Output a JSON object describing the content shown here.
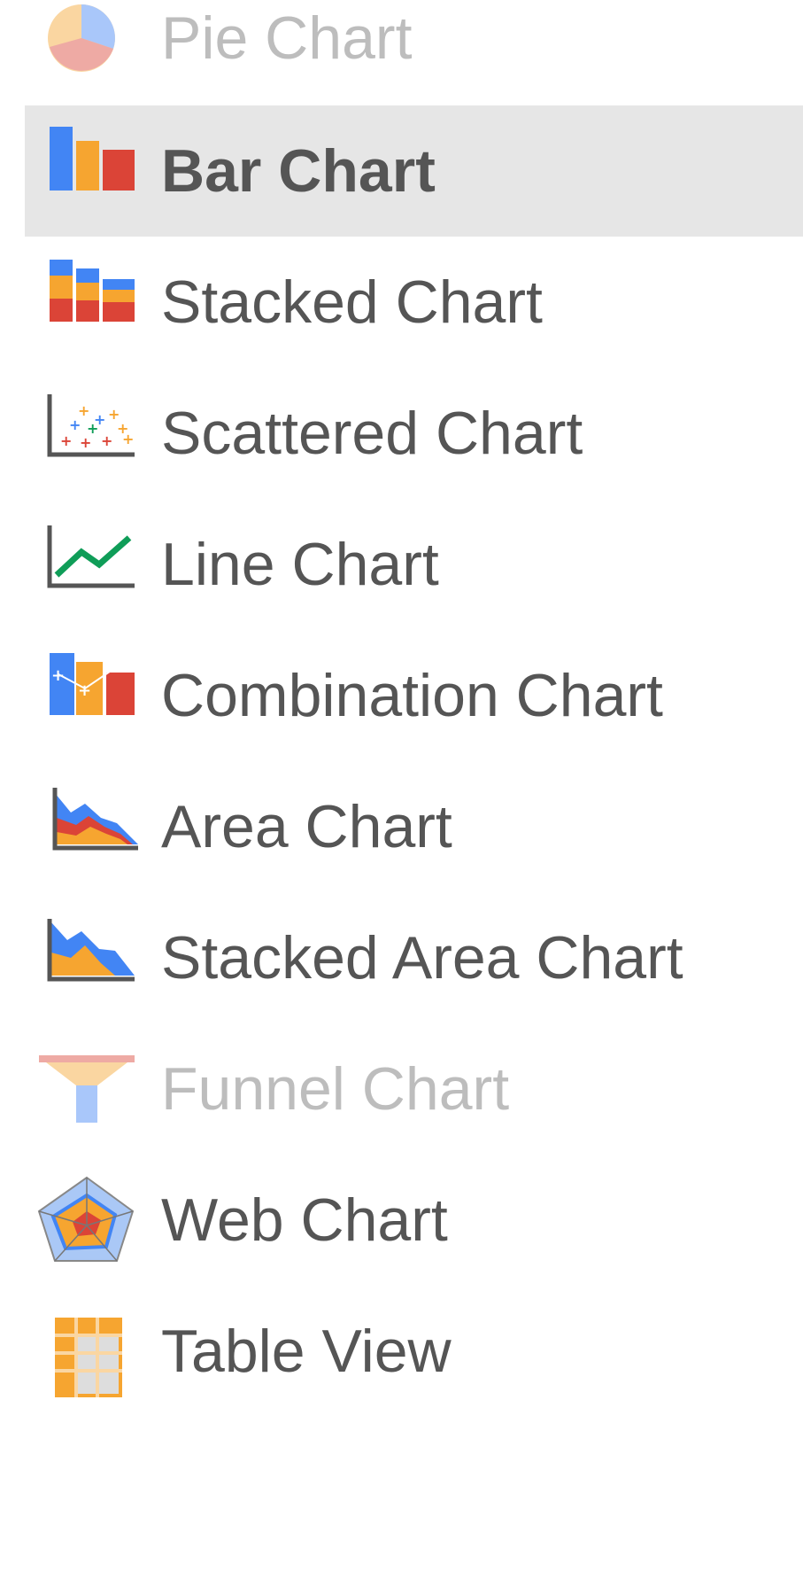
{
  "chart_menu": {
    "items": [
      {
        "label": "Pie Chart",
        "icon": "pie-chart-icon",
        "state": "disabled"
      },
      {
        "label": "Bar Chart",
        "icon": "bar-chart-icon",
        "state": "selected"
      },
      {
        "label": "Stacked Chart",
        "icon": "stacked-chart-icon",
        "state": "normal"
      },
      {
        "label": "Scattered Chart",
        "icon": "scatter-chart-icon",
        "state": "normal"
      },
      {
        "label": "Line Chart",
        "icon": "line-chart-icon",
        "state": "normal"
      },
      {
        "label": "Combination Chart",
        "icon": "combination-chart-icon",
        "state": "normal"
      },
      {
        "label": "Area Chart",
        "icon": "area-chart-icon",
        "state": "normal"
      },
      {
        "label": "Stacked Area Chart",
        "icon": "stacked-area-chart-icon",
        "state": "normal"
      },
      {
        "label": "Funnel Chart",
        "icon": "funnel-chart-icon",
        "state": "disabled"
      },
      {
        "label": "Web Chart",
        "icon": "web-chart-icon",
        "state": "normal"
      },
      {
        "label": "Table View",
        "icon": "table-view-icon",
        "state": "normal"
      }
    ]
  },
  "colors": {
    "text": "#555555",
    "text_disabled": "#bdbdbd",
    "selected_background": "#e6e6e6",
    "blue": "#4285f4",
    "orange": "#f6a530",
    "red": "#db4437",
    "green": "#0f9d58"
  }
}
